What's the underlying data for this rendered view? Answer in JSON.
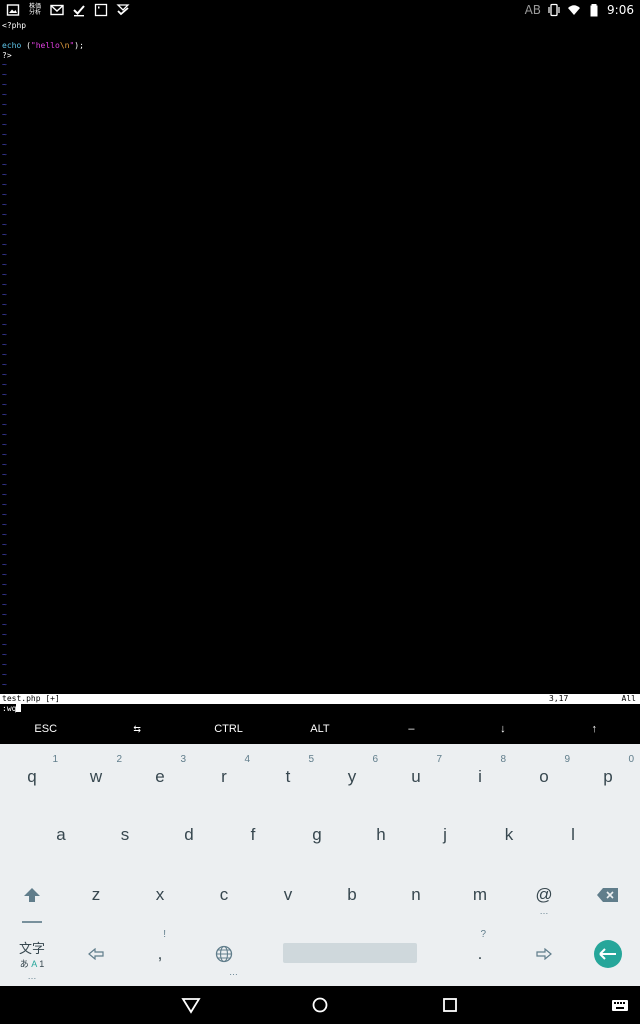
{
  "status_bar": {
    "left_icons": [
      "image-icon",
      "stock-analysis-icon",
      "gmail-icon",
      "check-icon",
      "dialog-icon",
      "todo-icon"
    ],
    "stock_icon_text": "株価\n分析",
    "right_text": "AB",
    "time": "9:06"
  },
  "editor": {
    "lines": {
      "l1": "<?php",
      "l2": "",
      "l3_kw": "echo",
      "l3_open": " (",
      "l3_q1": "\"hello",
      "l3_esc": "\\n",
      "l3_q2": "\"",
      "l3_close": ");",
      "l4": "?>"
    },
    "tilde": "~",
    "tilde_count": 63,
    "status_file": "test.php [+]",
    "status_pos": "3,17",
    "status_all": "All",
    "command": ":wq"
  },
  "extra_keys": [
    "ESC",
    "⇆",
    "CTRL",
    "ALT",
    "–",
    "↓",
    "↑"
  ],
  "keyboard": {
    "row1": [
      {
        "k": "q",
        "h": "1"
      },
      {
        "k": "w",
        "h": "2"
      },
      {
        "k": "e",
        "h": "3"
      },
      {
        "k": "r",
        "h": "4"
      },
      {
        "k": "t",
        "h": "5"
      },
      {
        "k": "y",
        "h": "6"
      },
      {
        "k": "u",
        "h": "7"
      },
      {
        "k": "i",
        "h": "8"
      },
      {
        "k": "o",
        "h": "9"
      },
      {
        "k": "p",
        "h": "0"
      }
    ],
    "row2": [
      "a",
      "s",
      "d",
      "f",
      "g",
      "h",
      "j",
      "k",
      "l"
    ],
    "row3": [
      "z",
      "x",
      "c",
      "v",
      "b",
      "n",
      "m",
      "@"
    ],
    "mode_label": "文字",
    "mode_sub_a": "あ",
    "mode_sub_b": "A",
    "mode_sub_c": "1",
    "comma": ",",
    "comma_hint": "!",
    "period": ".",
    "period_hint": "?",
    "ellipsis": "…",
    "accent_color": "#26A69A"
  },
  "nav_bar": {
    "buttons": [
      "back-icon",
      "home-icon",
      "recents-icon",
      "keyboard-switch-icon"
    ]
  }
}
